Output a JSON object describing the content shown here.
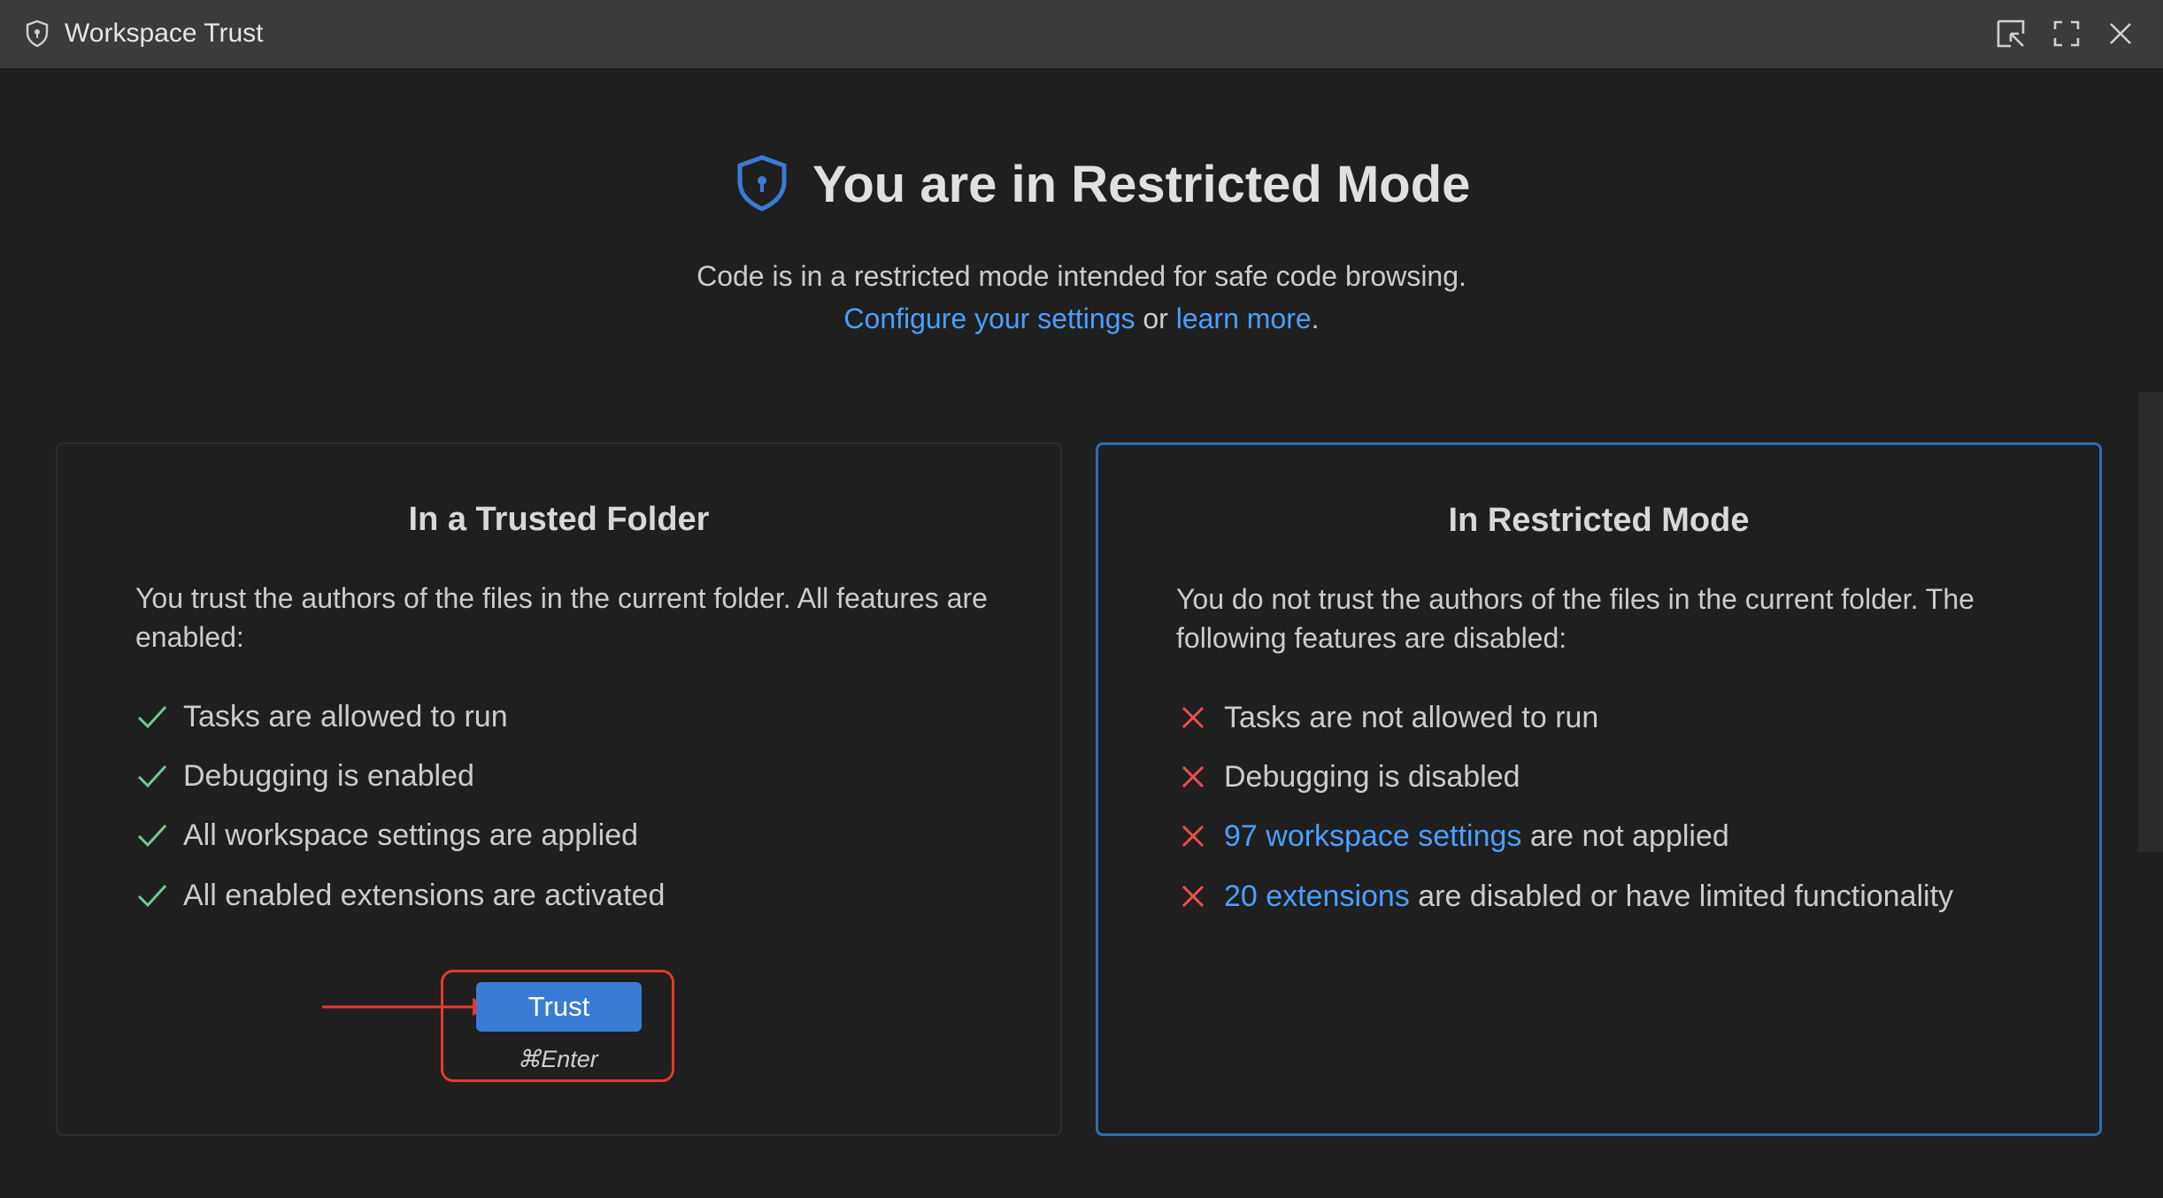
{
  "window": {
    "title": "Workspace Trust",
    "controls": {
      "pin_icon": "pin-window-icon",
      "maximize_icon": "maximize-icon",
      "close_icon": "close-icon"
    }
  },
  "hero": {
    "title": "You are in Restricted Mode",
    "subtitle": "Code is in a restricted mode intended for safe code browsing.",
    "configure_link": "Configure your settings",
    "or_text": " or ",
    "learn_more_link": "learn more",
    "period": "."
  },
  "trusted_card": {
    "title": "In a Trusted Folder",
    "description": "You trust the authors of the files in the current folder. All features are enabled:",
    "features": [
      "Tasks are allowed to run",
      "Debugging is enabled",
      "All workspace settings are applied",
      "All enabled extensions are activated"
    ],
    "trust_button_label": "Trust",
    "shortcut": "⌘Enter"
  },
  "restricted_card": {
    "title": "In Restricted Mode",
    "description": "You do not trust the authors of the files in the current folder. The following features are disabled:",
    "features": {
      "tasks": "Tasks are not allowed to run",
      "debugging": "Debugging is disabled",
      "settings_link": "97 workspace settings",
      "settings_rest": " are not applied",
      "extensions_link": "20 extensions",
      "extensions_rest": " are disabled or have limited functionality"
    }
  },
  "colors": {
    "background": "#1f1f1f",
    "titlebar": "#3b3b3b",
    "link": "#4b9fff",
    "accent_border": "#2f6db2",
    "button": "#3a7bd5",
    "check": "#73c991",
    "cross": "#f14c4c",
    "annotation": "#e23b2e"
  }
}
